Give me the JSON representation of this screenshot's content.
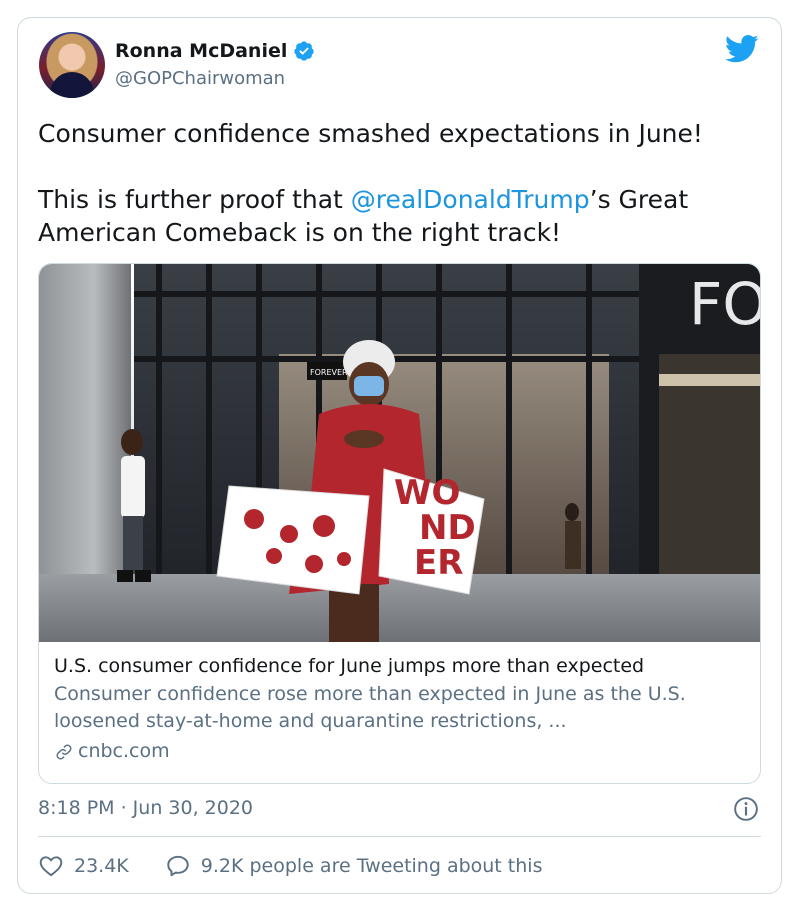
{
  "author": {
    "display_name": "Ronna McDaniel",
    "handle": "@GOPChairwoman",
    "verified": true
  },
  "tweet": {
    "line1": "Consumer confidence smashed expectations in June!",
    "line2_prefix": "This is further proof that ",
    "mention": "@realDonaldTrump",
    "line2_suffix": "’s Great American Comeback is on the right track!"
  },
  "link_card": {
    "title": "U.S. consumer confidence for June jumps more than expected",
    "description": "Consumer confidence rose more than expected in June as the U.S. loosened stay-at-home and quarantine restrictions, ...",
    "domain": "cnbc.com",
    "image_sign_text": "FO",
    "image_store_label": "FOREVER 21",
    "image_bag_text": [
      "WO",
      "ND",
      "ER"
    ]
  },
  "timestamp": "8:18 PM · Jun 30, 2020",
  "stats": {
    "likes": "23.4K",
    "tweeting": "9.2K people are Tweeting about this"
  },
  "colors": {
    "accent": "#1b95e0",
    "text": "#14171a",
    "muted": "#5b7083",
    "border": "#cfd9de",
    "verified": "#1da1f2"
  },
  "icons": {
    "verified": "verified-badge-icon",
    "bird": "twitter-bird-icon",
    "info": "info-icon",
    "like": "heart-icon",
    "reply": "speech-bubble-icon",
    "link": "link-icon"
  }
}
